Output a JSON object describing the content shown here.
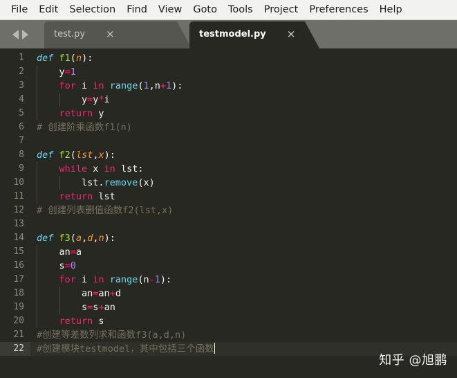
{
  "app": {
    "name": "Sublime Text",
    "theme_background": "#272822",
    "accent_pink": "#f92672",
    "accent_green": "#a6e22e",
    "accent_cyan": "#66d9ef",
    "accent_purple": "#ae81ff",
    "accent_orange": "#fd971f",
    "comment_color": "#75715e"
  },
  "menubar": {
    "items": [
      {
        "label": "File"
      },
      {
        "label": "Edit"
      },
      {
        "label": "Selection"
      },
      {
        "label": "Find"
      },
      {
        "label": "View"
      },
      {
        "label": "Goto"
      },
      {
        "label": "Tools"
      },
      {
        "label": "Project"
      },
      {
        "label": "Preferences"
      },
      {
        "label": "Help"
      }
    ]
  },
  "tabbar": {
    "nav_prev_icon": "triangle-left-icon",
    "nav_next_icon": "triangle-right-icon",
    "close_glyph": "×",
    "tabs": [
      {
        "label": "test.py",
        "active": false
      },
      {
        "label": "testmodel.py",
        "active": true
      }
    ]
  },
  "editor": {
    "language": "Python",
    "current_line": 22,
    "cursor_visible": true,
    "lines": [
      {
        "num": "1",
        "text": "def f1(n):"
      },
      {
        "num": "2",
        "text": "    y=1"
      },
      {
        "num": "3",
        "text": "    for i in range(1,n+1):"
      },
      {
        "num": "4",
        "text": "        y=y*i"
      },
      {
        "num": "5",
        "text": "    return y"
      },
      {
        "num": "6",
        "text": "# 创建阶乘函数f1(n)"
      },
      {
        "num": "7",
        "text": ""
      },
      {
        "num": "8",
        "text": "def f2(lst,x):"
      },
      {
        "num": "9",
        "text": "    while x in lst:"
      },
      {
        "num": "10",
        "text": "        lst.remove(x)"
      },
      {
        "num": "11",
        "text": "    return lst"
      },
      {
        "num": "12",
        "text": "# 创建列表删值函数f2(lst,x)"
      },
      {
        "num": "13",
        "text": ""
      },
      {
        "num": "14",
        "text": "def f3(a,d,n):"
      },
      {
        "num": "15",
        "text": "    an=a"
      },
      {
        "num": "16",
        "text": "    s=0"
      },
      {
        "num": "17",
        "text": "    for i in range(n-1):"
      },
      {
        "num": "18",
        "text": "        an=an+d"
      },
      {
        "num": "19",
        "text": "        s=s+an"
      },
      {
        "num": "20",
        "text": "    return s"
      },
      {
        "num": "21",
        "text": "#创建等差数列求和函数f3(a,d,n)"
      },
      {
        "num": "22",
        "text": "#创建模块testmodel，其中包括三个函数"
      }
    ],
    "tokens": [
      [
        {
          "t": "def",
          "c": "tok-def"
        },
        {
          "t": " ",
          "c": "tok-pl"
        },
        {
          "t": "f1",
          "c": "tok-fn"
        },
        {
          "t": "(",
          "c": "tok-pl"
        },
        {
          "t": "n",
          "c": "tok-param"
        },
        {
          "t": "):",
          "c": "tok-pl"
        }
      ],
      [
        {
          "t": "    y",
          "c": "tok-pl"
        },
        {
          "t": "=",
          "c": "tok-kw"
        },
        {
          "t": "1",
          "c": "tok-num"
        }
      ],
      [
        {
          "t": "    ",
          "c": "tok-pl"
        },
        {
          "t": "for",
          "c": "tok-kw"
        },
        {
          "t": " i ",
          "c": "tok-pl"
        },
        {
          "t": "in",
          "c": "tok-kw"
        },
        {
          "t": " ",
          "c": "tok-pl"
        },
        {
          "t": "range",
          "c": "tok-call"
        },
        {
          "t": "(",
          "c": "tok-pl"
        },
        {
          "t": "1",
          "c": "tok-num"
        },
        {
          "t": ",n",
          "c": "tok-pl"
        },
        {
          "t": "+",
          "c": "tok-kw"
        },
        {
          "t": "1",
          "c": "tok-num"
        },
        {
          "t": "):",
          "c": "tok-pl"
        }
      ],
      [
        {
          "t": "        y",
          "c": "tok-pl"
        },
        {
          "t": "=",
          "c": "tok-kw"
        },
        {
          "t": "y",
          "c": "tok-pl"
        },
        {
          "t": "*",
          "c": "tok-kw"
        },
        {
          "t": "i",
          "c": "tok-pl"
        }
      ],
      [
        {
          "t": "    ",
          "c": "tok-pl"
        },
        {
          "t": "return",
          "c": "tok-kw"
        },
        {
          "t": " y",
          "c": "tok-pl"
        }
      ],
      [
        {
          "t": "# 创建阶乘函数f1(n)",
          "c": "tok-com"
        }
      ],
      [],
      [
        {
          "t": "def",
          "c": "tok-def"
        },
        {
          "t": " ",
          "c": "tok-pl"
        },
        {
          "t": "f2",
          "c": "tok-fn"
        },
        {
          "t": "(",
          "c": "tok-pl"
        },
        {
          "t": "lst",
          "c": "tok-param"
        },
        {
          "t": ",",
          "c": "tok-pl"
        },
        {
          "t": "x",
          "c": "tok-param"
        },
        {
          "t": "):",
          "c": "tok-pl"
        }
      ],
      [
        {
          "t": "    ",
          "c": "tok-pl"
        },
        {
          "t": "while",
          "c": "tok-kw"
        },
        {
          "t": " x ",
          "c": "tok-pl"
        },
        {
          "t": "in",
          "c": "tok-kw"
        },
        {
          "t": " lst:",
          "c": "tok-pl"
        }
      ],
      [
        {
          "t": "        lst.",
          "c": "tok-pl"
        },
        {
          "t": "remove",
          "c": "tok-call"
        },
        {
          "t": "(x)",
          "c": "tok-pl"
        }
      ],
      [
        {
          "t": "    ",
          "c": "tok-pl"
        },
        {
          "t": "return",
          "c": "tok-kw"
        },
        {
          "t": " lst",
          "c": "tok-pl"
        }
      ],
      [
        {
          "t": "# 创建列表删值函数f2(lst,x)",
          "c": "tok-com"
        }
      ],
      [],
      [
        {
          "t": "def",
          "c": "tok-def"
        },
        {
          "t": " ",
          "c": "tok-pl"
        },
        {
          "t": "f3",
          "c": "tok-fn"
        },
        {
          "t": "(",
          "c": "tok-pl"
        },
        {
          "t": "a",
          "c": "tok-param"
        },
        {
          "t": ",",
          "c": "tok-pl"
        },
        {
          "t": "d",
          "c": "tok-param"
        },
        {
          "t": ",",
          "c": "tok-pl"
        },
        {
          "t": "n",
          "c": "tok-param"
        },
        {
          "t": "):",
          "c": "tok-pl"
        }
      ],
      [
        {
          "t": "    an",
          "c": "tok-pl"
        },
        {
          "t": "=",
          "c": "tok-kw"
        },
        {
          "t": "a",
          "c": "tok-pl"
        }
      ],
      [
        {
          "t": "    s",
          "c": "tok-pl"
        },
        {
          "t": "=",
          "c": "tok-kw"
        },
        {
          "t": "0",
          "c": "tok-num"
        }
      ],
      [
        {
          "t": "    ",
          "c": "tok-pl"
        },
        {
          "t": "for",
          "c": "tok-kw"
        },
        {
          "t": " i ",
          "c": "tok-pl"
        },
        {
          "t": "in",
          "c": "tok-kw"
        },
        {
          "t": " ",
          "c": "tok-pl"
        },
        {
          "t": "range",
          "c": "tok-call"
        },
        {
          "t": "(n",
          "c": "tok-pl"
        },
        {
          "t": "-",
          "c": "tok-kw"
        },
        {
          "t": "1",
          "c": "tok-num"
        },
        {
          "t": "):",
          "c": "tok-pl"
        }
      ],
      [
        {
          "t": "        an",
          "c": "tok-pl"
        },
        {
          "t": "=",
          "c": "tok-kw"
        },
        {
          "t": "an",
          "c": "tok-pl"
        },
        {
          "t": "+",
          "c": "tok-kw"
        },
        {
          "t": "d",
          "c": "tok-pl"
        }
      ],
      [
        {
          "t": "        s",
          "c": "tok-pl"
        },
        {
          "t": "=",
          "c": "tok-kw"
        },
        {
          "t": "s",
          "c": "tok-pl"
        },
        {
          "t": "+",
          "c": "tok-kw"
        },
        {
          "t": "an",
          "c": "tok-pl"
        }
      ],
      [
        {
          "t": "    ",
          "c": "tok-pl"
        },
        {
          "t": "return",
          "c": "tok-kw"
        },
        {
          "t": " s",
          "c": "tok-pl"
        }
      ],
      [
        {
          "t": "#创建等差数列求和函数f3(a,d,n)",
          "c": "tok-com"
        }
      ],
      [
        {
          "t": "#创建模块testmodel，其中包括三个函数",
          "c": "tok-com"
        }
      ]
    ],
    "indent_guides": [
      [],
      [
        1
      ],
      [
        1
      ],
      [
        1,
        2
      ],
      [
        1
      ],
      [],
      [],
      [],
      [
        1
      ],
      [
        1,
        2
      ],
      [
        1
      ],
      [],
      [],
      [],
      [
        1
      ],
      [
        1
      ],
      [
        1
      ],
      [
        1,
        2
      ],
      [
        1,
        2
      ],
      [
        1
      ],
      [],
      []
    ]
  },
  "watermark": {
    "text": "知乎 @旭鹏"
  }
}
